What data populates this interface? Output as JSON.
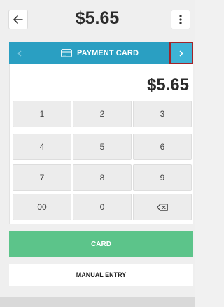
{
  "header": {
    "back_icon": "arrow-left-icon",
    "amount": "$5.65",
    "more_icon": "vertical-dots-icon"
  },
  "payment_bar": {
    "label": "PAYMENT CARD",
    "icon": "credit-card-icon",
    "prev_icon": "chevron-left-icon",
    "next_icon": "chevron-right-icon",
    "bar_color": "#2a9fc2",
    "highlight_color": "#a1242a"
  },
  "display": {
    "amount": "$5.65"
  },
  "keypad": {
    "keys": [
      "1",
      "2",
      "3",
      "4",
      "5",
      "6",
      "7",
      "8",
      "9",
      "00",
      "0"
    ],
    "backspace_icon": "backspace-icon"
  },
  "actions": {
    "card_label": "CARD",
    "card_color": "#5cc48a",
    "manual_label": "MANUAL ENTRY"
  }
}
